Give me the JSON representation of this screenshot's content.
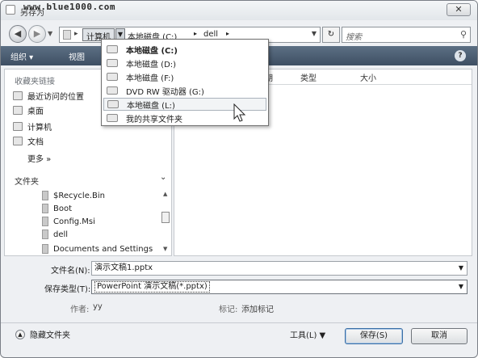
{
  "window": {
    "title": "另存为",
    "watermark": "www.blue1000.com",
    "close_glyph": "✕"
  },
  "address": {
    "crumbs": [
      "计算机",
      "本地磁盘 (C:)",
      "dell"
    ],
    "search_placeholder": "搜索"
  },
  "toolbar": {
    "organize": "组织 ▾",
    "view": "视图"
  },
  "nav": {
    "favorites_header": "收藏夹链接",
    "items": [
      "最近访问的位置",
      "桌面",
      "计算机",
      "文档"
    ],
    "more": "更多 »",
    "folders_header": "文件夹",
    "folders": [
      "$Recycle.Bin",
      "Boot",
      "Config.Msi",
      "dell",
      "Documents and Settings"
    ]
  },
  "columns": [
    "期",
    "类型",
    "大小"
  ],
  "dropdown": {
    "items": [
      {
        "label": "本地磁盘 (C:)",
        "icon": "drive-icon"
      },
      {
        "label": "本地磁盘 (D:)",
        "icon": "drive-icon"
      },
      {
        "label": "本地磁盘 (F:)",
        "icon": "drive-icon"
      },
      {
        "label": "DVD RW 驱动器 (G:)",
        "icon": "dvd-icon"
      },
      {
        "label": "本地磁盘 (L:)",
        "icon": "drive-icon"
      },
      {
        "label": "我的共享文件夹",
        "icon": "shared-folder-icon"
      }
    ]
  },
  "form": {
    "filename_label": "文件名(N):",
    "filename_value": "演示文稿1.pptx",
    "type_label": "保存类型(T):",
    "type_value": "PowerPoint 演示文稿(*.pptx)",
    "author_label": "作者:",
    "author_value": "yy",
    "tags_label": "标记:",
    "tags_value": "添加标记"
  },
  "footer": {
    "hide_folders": "隐藏文件夹",
    "tools": "工具(L)  ▼",
    "save": "保存(S)",
    "cancel": "取消"
  }
}
